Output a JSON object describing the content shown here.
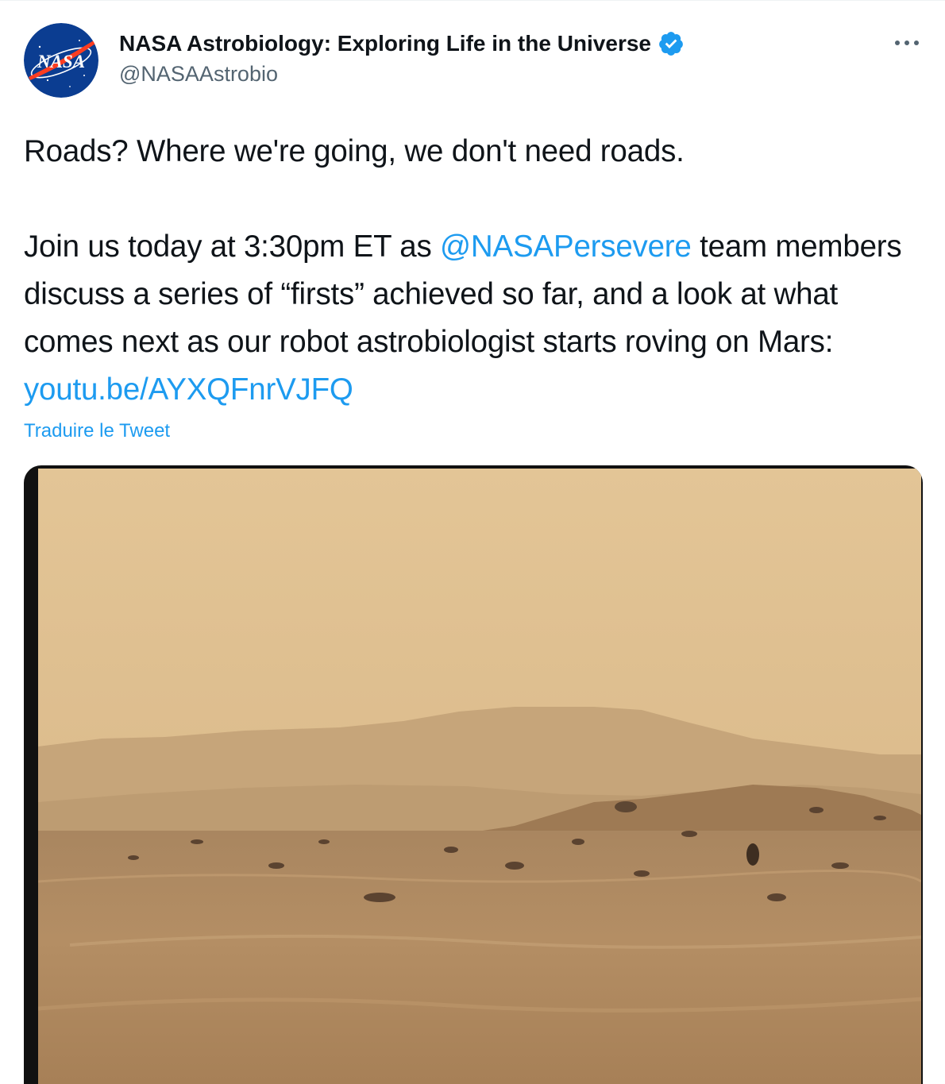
{
  "author": {
    "display_name": "NASA Astrobiology: Exploring Life in the Universe",
    "handle": "@NASAAstrobio",
    "verified": true,
    "avatar_logo_text": "NASA"
  },
  "tweet": {
    "line1": "Roads? Where we're going, we don't need roads.",
    "join_prefix": "Join us today at 3:30pm ET as ",
    "mention": "@NASAPersevere",
    "join_suffix": " team members discuss a series of “firsts” achieved so far, and a look at what comes next as our robot astrobiologist starts roving on Mars: ",
    "link": "youtu.be/AYXQFnrVJFQ",
    "translate_label": "Traduire le Tweet"
  },
  "icons": {
    "more": "more-horizontal-icon",
    "verified": "verified-badge-icon",
    "avatar": "nasa-meatball-logo"
  },
  "colors": {
    "link": "#1d9bf0",
    "secondary_text": "#536471",
    "verified": "#1d9bf0"
  }
}
